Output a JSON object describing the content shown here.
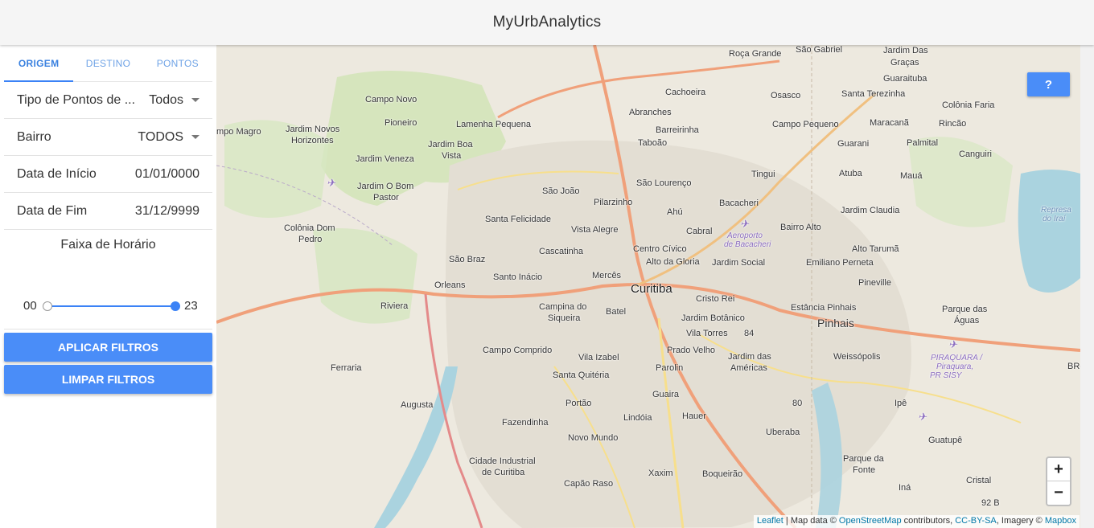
{
  "app": {
    "title": "MyUrbAnalytics"
  },
  "tabs": [
    {
      "label": "ORIGEM",
      "active": true
    },
    {
      "label": "DESTINO",
      "active": false
    },
    {
      "label": "PONTOS",
      "active": false
    }
  ],
  "filters": {
    "tipo_label": "Tipo de Pontos de ...",
    "tipo_value": "Todos",
    "bairro_label": "Bairro",
    "bairro_value": "TODOS",
    "inicio_label": "Data de Início",
    "inicio_value": "01/01/0000",
    "fim_label": "Data de Fim",
    "fim_value": "31/12/9999"
  },
  "hour_range": {
    "title": "Faixa de Horário",
    "min_label": "00",
    "max_label": "23",
    "min": 0,
    "max": 23,
    "low": 0,
    "high": 23
  },
  "buttons": {
    "apply": "APLICAR FILTROS",
    "clear": "LIMPAR FILTROS",
    "help": "?"
  },
  "map": {
    "zoom_in": "+",
    "zoom_out": "−",
    "attribution": {
      "leaflet": "Leaflet",
      "sep1": " | Map data © ",
      "osm": "OpenStreetMap",
      "sep2": " contributors, ",
      "license": "CC-BY-SA",
      "sep3": ", Imagery © ",
      "mapbox": "Mapbox"
    },
    "places": [
      {
        "name": "Roça Grande",
        "cls": ""
      },
      {
        "name": "São Gabriel",
        "cls": ""
      },
      {
        "name": "Jardim Das",
        "cls": ""
      },
      {
        "name": "Graças",
        "cls": ""
      },
      {
        "name": "Guaraituba",
        "cls": ""
      },
      {
        "name": "Campo Novo",
        "cls": ""
      },
      {
        "name": "Cachoeira",
        "cls": ""
      },
      {
        "name": "Osasco",
        "cls": ""
      },
      {
        "name": "Santa Terezinha",
        "cls": ""
      },
      {
        "name": "Colônia Faria",
        "cls": ""
      },
      {
        "name": "Abranches",
        "cls": ""
      },
      {
        "name": "Pioneiro",
        "cls": ""
      },
      {
        "name": "Lamenha Pequena",
        "cls": ""
      },
      {
        "name": "Barreirinha",
        "cls": ""
      },
      {
        "name": "Campo Pequeno",
        "cls": ""
      },
      {
        "name": "Maracanã",
        "cls": ""
      },
      {
        "name": "Rincão",
        "cls": ""
      },
      {
        "name": "mpo Magro",
        "cls": ""
      },
      {
        "name": "Jardim Novos",
        "cls": ""
      },
      {
        "name": "Horizontes",
        "cls": ""
      },
      {
        "name": "Jardim Boa",
        "cls": ""
      },
      {
        "name": "Vista",
        "cls": ""
      },
      {
        "name": "Taboão",
        "cls": ""
      },
      {
        "name": "Guarani",
        "cls": ""
      },
      {
        "name": "Palmital",
        "cls": ""
      },
      {
        "name": "Canguiri",
        "cls": ""
      },
      {
        "name": "Jardim Veneza",
        "cls": ""
      },
      {
        "name": "Tingui",
        "cls": ""
      },
      {
        "name": "Atuba",
        "cls": ""
      },
      {
        "name": "Mauá",
        "cls": ""
      },
      {
        "name": "Jardim O Bom",
        "cls": ""
      },
      {
        "name": "Pastor",
        "cls": ""
      },
      {
        "name": "São João",
        "cls": ""
      },
      {
        "name": "São Lourenço",
        "cls": ""
      },
      {
        "name": "Pilarzinho",
        "cls": ""
      },
      {
        "name": "Bacacheri",
        "cls": ""
      },
      {
        "name": "Jardim Claudia",
        "cls": ""
      },
      {
        "name": "Represa",
        "cls": "water"
      },
      {
        "name": "do Iraí",
        "cls": "water"
      },
      {
        "name": "Ahú",
        "cls": ""
      },
      {
        "name": "Santa Felicidade",
        "cls": ""
      },
      {
        "name": "Colônia Dom",
        "cls": ""
      },
      {
        "name": "Pedro",
        "cls": ""
      },
      {
        "name": "Vista Alegre",
        "cls": ""
      },
      {
        "name": "Cabral",
        "cls": ""
      },
      {
        "name": "Bairro Alto",
        "cls": ""
      },
      {
        "name": "Aeroporto",
        "cls": "airport"
      },
      {
        "name": "de Bacacheri",
        "cls": "airport"
      },
      {
        "name": "Alto Tarumã",
        "cls": ""
      },
      {
        "name": "Cascatinha",
        "cls": ""
      },
      {
        "name": "Centro Cívico",
        "cls": ""
      },
      {
        "name": "São Braz",
        "cls": ""
      },
      {
        "name": "Alto da Gloria",
        "cls": ""
      },
      {
        "name": "Jardim Social",
        "cls": ""
      },
      {
        "name": "Emiliano Perneta",
        "cls": ""
      },
      {
        "name": "Mercês",
        "cls": ""
      },
      {
        "name": "Santo Inácio",
        "cls": ""
      },
      {
        "name": "Pineville",
        "cls": ""
      },
      {
        "name": "Orleans",
        "cls": ""
      },
      {
        "name": "Curitiba",
        "cls": "big"
      },
      {
        "name": "Cristo Rei",
        "cls": ""
      },
      {
        "name": "Riviera",
        "cls": ""
      },
      {
        "name": "Campina do",
        "cls": ""
      },
      {
        "name": "Siqueira",
        "cls": ""
      },
      {
        "name": "Batel",
        "cls": ""
      },
      {
        "name": "Estância Pinhais",
        "cls": ""
      },
      {
        "name": "Parque das",
        "cls": ""
      },
      {
        "name": "Águas",
        "cls": ""
      },
      {
        "name": "Jardim Botânico",
        "cls": ""
      },
      {
        "name": "Pinhais",
        "cls": "mid"
      },
      {
        "name": "Vila Torres",
        "cls": ""
      },
      {
        "name": "Campo Comprido",
        "cls": ""
      },
      {
        "name": "Vila Izabel",
        "cls": ""
      },
      {
        "name": "Prado Velho",
        "cls": ""
      },
      {
        "name": "Jardim das",
        "cls": ""
      },
      {
        "name": "Américas",
        "cls": ""
      },
      {
        "name": "Weissópolis",
        "cls": ""
      },
      {
        "name": "PIRAQUARA /",
        "cls": "airport"
      },
      {
        "name": "Piraquara,",
        "cls": "airport"
      },
      {
        "name": "PR SISY",
        "cls": "airport"
      },
      {
        "name": "Ferraria",
        "cls": ""
      },
      {
        "name": "Parolin",
        "cls": ""
      },
      {
        "name": "Santa Quitéria",
        "cls": ""
      },
      {
        "name": "Guaira",
        "cls": ""
      },
      {
        "name": "Augusta",
        "cls": ""
      },
      {
        "name": "Portão",
        "cls": ""
      },
      {
        "name": "Ipê",
        "cls": ""
      },
      {
        "name": "Lindóia",
        "cls": ""
      },
      {
        "name": "Hauer",
        "cls": ""
      },
      {
        "name": "Fazendinha",
        "cls": ""
      },
      {
        "name": "Uberaba",
        "cls": ""
      },
      {
        "name": "Guatupê",
        "cls": ""
      },
      {
        "name": "Novo Mundo",
        "cls": ""
      },
      {
        "name": "Parque da",
        "cls": ""
      },
      {
        "name": "Fonte",
        "cls": ""
      },
      {
        "name": "Cidade Industrial",
        "cls": ""
      },
      {
        "name": "de Curitiba",
        "cls": ""
      },
      {
        "name": "Xaxim",
        "cls": ""
      },
      {
        "name": "Boqueirão",
        "cls": ""
      },
      {
        "name": "Capão Raso",
        "cls": ""
      },
      {
        "name": "Cristal",
        "cls": ""
      },
      {
        "name": "Iná",
        "cls": ""
      },
      {
        "name": "84",
        "cls": ""
      },
      {
        "name": "80",
        "cls": ""
      },
      {
        "name": "BR-",
        "cls": ""
      },
      {
        "name": "92 B",
        "cls": ""
      }
    ]
  }
}
